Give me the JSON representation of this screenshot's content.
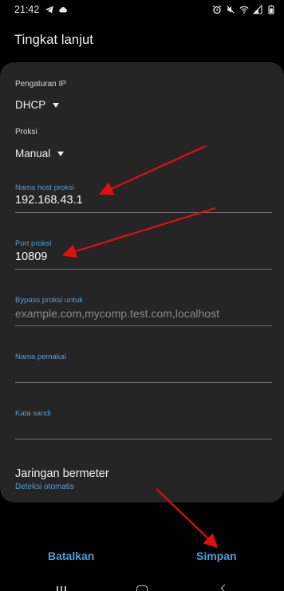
{
  "status_bar": {
    "time": "21:42",
    "left_icons": [
      "telegram-icon",
      "cloud-icon"
    ],
    "right_icons": [
      "alarm-icon",
      "mute-icon",
      "wifi-icon",
      "signal-icon",
      "battery-icon"
    ]
  },
  "page": {
    "title": "Tingkat lanjut"
  },
  "form": {
    "ip_settings": {
      "label": "Pengaturan IP",
      "value": "DHCP"
    },
    "proxy": {
      "label": "Proksi",
      "value": "Manual"
    },
    "proxy_host": {
      "label": "Nama host proksi",
      "value": "192.168.43.1"
    },
    "proxy_port": {
      "label": "Port proksi",
      "value": "10809"
    },
    "bypass": {
      "label": "Bypass proksi untuk",
      "placeholder": "example.com,mycomp.test.com,localhost"
    },
    "username": {
      "label": "Nama pemakai",
      "value": ""
    },
    "password": {
      "label": "Kata sandi",
      "value": ""
    },
    "metered": {
      "title": "Jaringan bermeter",
      "value": "Deteksi otomatis"
    }
  },
  "buttons": {
    "cancel": "Batalkan",
    "save": "Simpan"
  },
  "colors": {
    "accent": "#4f9ddc",
    "card_bg": "#252525",
    "screen_bg": "#000000",
    "annotation_arrow": "#e01010"
  }
}
